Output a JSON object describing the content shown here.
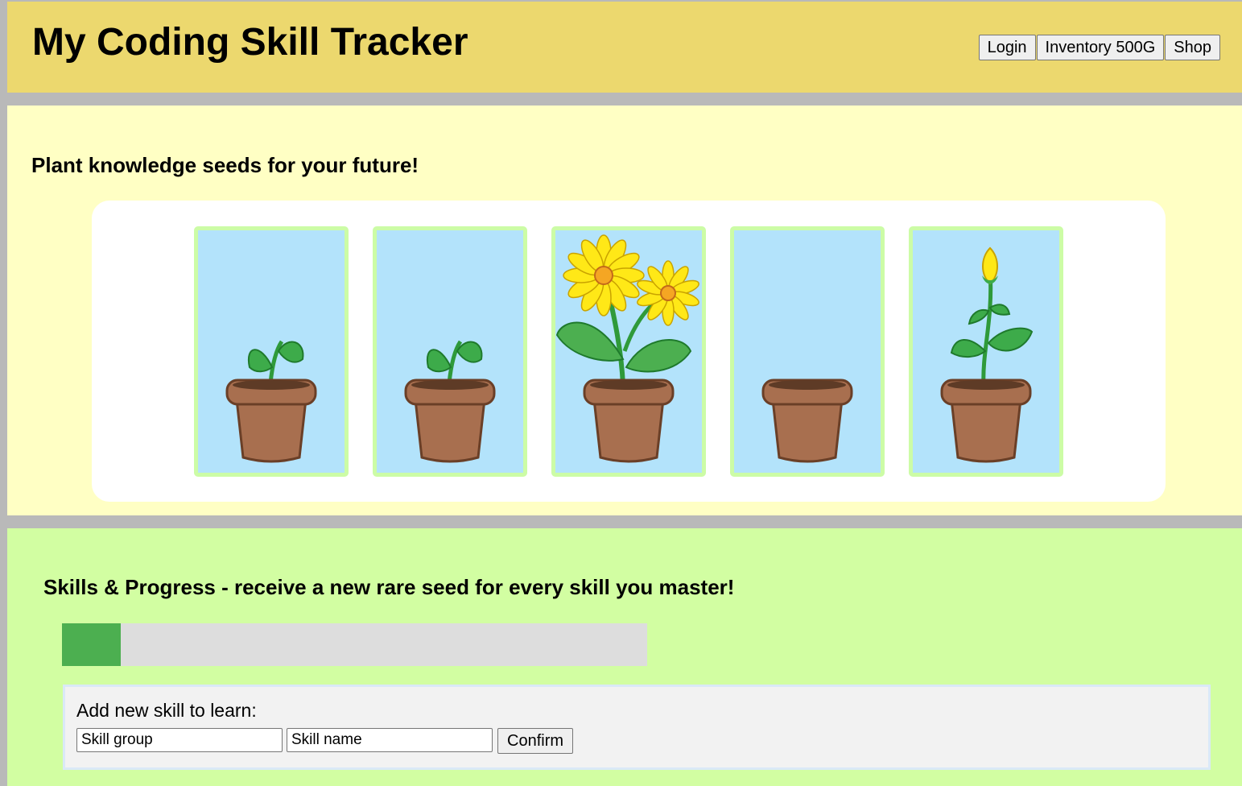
{
  "header": {
    "title": "My Coding Skill Tracker",
    "nav": {
      "login": "Login",
      "inventory": "Inventory 500G",
      "shop": "Shop"
    }
  },
  "garden": {
    "title": "Plant knowledge seeds for your future!",
    "plots": [
      {
        "stage": "sprout",
        "icon": "sprout-pot-icon"
      },
      {
        "stage": "sprout",
        "icon": "sprout-pot-icon"
      },
      {
        "stage": "sunflowers",
        "icon": "sunflower-pot-icon"
      },
      {
        "stage": "empty",
        "icon": "empty-pot-icon"
      },
      {
        "stage": "bud",
        "icon": "flower-bud-pot-icon"
      }
    ]
  },
  "skills": {
    "title": "Skills & Progress - receive a new rare seed for every skill you master!",
    "progress_fraction": 0.1,
    "add_form": {
      "label": "Add new skill to learn:",
      "group_value": "Skill group",
      "name_value": "Skill name",
      "confirm": "Confirm"
    }
  },
  "colors": {
    "header_bg": "#ecd86e",
    "garden_bg": "#ffffc4",
    "skills_bg": "#d2fea2",
    "plot_bg": "#b3e3fb",
    "plot_border": "#ccfca6",
    "progress_fill": "#4caf50",
    "pot": "#a86f4f"
  }
}
